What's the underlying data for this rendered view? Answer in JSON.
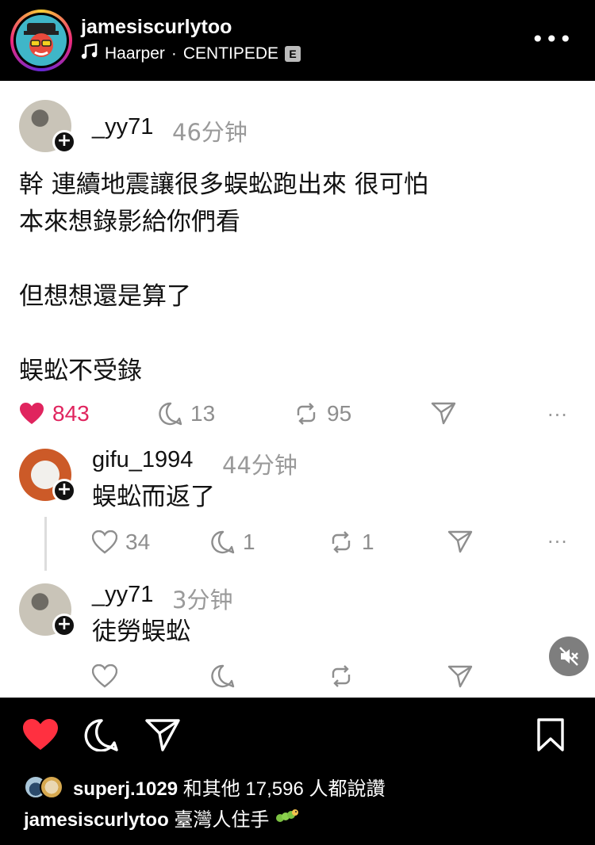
{
  "post": {
    "username": "jamesiscurlytoo",
    "music_artist": "Haarper",
    "music_separator": "·",
    "music_track": "CENTIPEDE",
    "explicit_badge": "E",
    "more_label": "•••"
  },
  "thread": {
    "original": {
      "username": "_yy71",
      "time": "46分钟",
      "text": "幹 連續地震讓很多蜈蚣跑出來 很可怕\n本來想錄影給你們看\n\n但想想還是算了\n\n蜈蚣不受錄",
      "likes": "843",
      "replies": "13",
      "reposts": "95"
    },
    "reply1": {
      "username": "gifu_1994",
      "time": "44分钟",
      "text": "蜈蚣而返了",
      "likes": "34",
      "replies": "1",
      "reposts": "1"
    },
    "reply2": {
      "username": "_yy71",
      "time": "3分钟",
      "text": "徒勞蜈蚣"
    },
    "dots": "···"
  },
  "footer": {
    "liked_by_user": "superj.1029",
    "liked_by_rest": "和其他 17,596 人都說讚",
    "caption_user": "jamesiscurlytoo",
    "caption_text": "臺灣人住手"
  },
  "colors": {
    "like_red": "#e0245e",
    "ig_red": "#ff3040"
  },
  "icons": [
    "music-note-icon",
    "heart-icon",
    "comment-icon",
    "repost-icon",
    "send-icon",
    "more-icon",
    "mute-icon",
    "bookmark-icon",
    "caterpillar-emoji-icon"
  ]
}
